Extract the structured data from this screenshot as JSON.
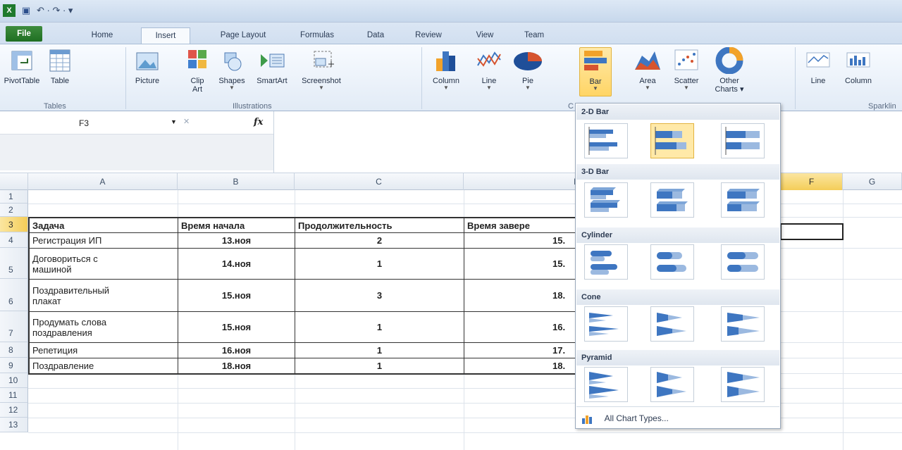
{
  "window": {
    "quick_access_glyph": "↶  ·  ↷  ·  ▾"
  },
  "tabs": [
    "File",
    "Home",
    "Insert",
    "Page Layout",
    "Formulas",
    "Data",
    "Review",
    "View",
    "Team"
  ],
  "ribbon": {
    "buttons": [
      {
        "label": "PivotTable",
        "icon": "pivottable-icon"
      },
      {
        "label": "Table",
        "icon": "table-icon"
      },
      {
        "label": "Picture",
        "icon": "picture-icon"
      },
      {
        "label": "Clip",
        "label2": "Art",
        "icon": "clipart-icon"
      },
      {
        "label": "Shapes",
        "icon": "shapes-icon"
      },
      {
        "label": "SmartArt",
        "icon": "smartart-icon"
      },
      {
        "label": "Screenshot",
        "icon": "screenshot-icon"
      },
      {
        "label": "Column",
        "icon": "column-chart-icon"
      },
      {
        "label": "Line",
        "icon": "line-chart-icon"
      },
      {
        "label": "Pie",
        "icon": "pie-chart-icon"
      },
      {
        "label": "Bar",
        "icon": "bar-chart-icon"
      },
      {
        "label": "Area",
        "icon": "area-chart-icon"
      },
      {
        "label": "Scatter",
        "icon": "scatter-chart-icon"
      },
      {
        "label": "Other",
        "label2": "Charts ▾",
        "icon": "other-charts-icon"
      },
      {
        "label": "Line",
        "icon": "sparkline-line-icon"
      },
      {
        "label": "Column",
        "icon": "sparkline-column-icon"
      }
    ],
    "groups": {
      "tables": "Tables",
      "illustrations": "Illustrations",
      "charts_partial": "C",
      "sparklines_partial": "Sparklin"
    }
  },
  "formula_bar": {
    "name_box": "F3",
    "fx": "fx",
    "cancel_glyph": "✕"
  },
  "columns": [
    "A",
    "B",
    "C",
    "D",
    "E",
    "F",
    "G"
  ],
  "rows": [
    "1",
    "2",
    "3",
    "4",
    "5",
    "6",
    "7",
    "8",
    "9",
    "10",
    "11",
    "12",
    "13"
  ],
  "table": {
    "headers": [
      "Задача",
      "Время начала",
      "Продолжительность",
      "Время заверe"
    ],
    "rows": [
      {
        "task": "Регистрация ИП",
        "start": "13.ноя",
        "duration": "2",
        "end": "15."
      },
      {
        "task": "Договориться с",
        "task2": "машиной",
        "start": "14.ноя",
        "duration": "1",
        "end": "15."
      },
      {
        "task": "Поздравительный",
        "task2": "плакат",
        "start": "15.ноя",
        "duration": "3",
        "end": "18."
      },
      {
        "task": "Продумать слова",
        "task2": "поздравления",
        "start": "15.ноя",
        "duration": "1",
        "end": "16."
      },
      {
        "task": "Репетиция",
        "start": "16.ноя",
        "duration": "1",
        "end": "17."
      },
      {
        "task": "Поздравление",
        "start": "18.ноя",
        "duration": "1",
        "end": "18."
      }
    ]
  },
  "dropdown": {
    "sections": [
      "2-D Bar",
      "3-D Bar",
      "Cylinder",
      "Cone",
      "Pyramid"
    ],
    "all_chart_types": "All Chart Types..."
  }
}
